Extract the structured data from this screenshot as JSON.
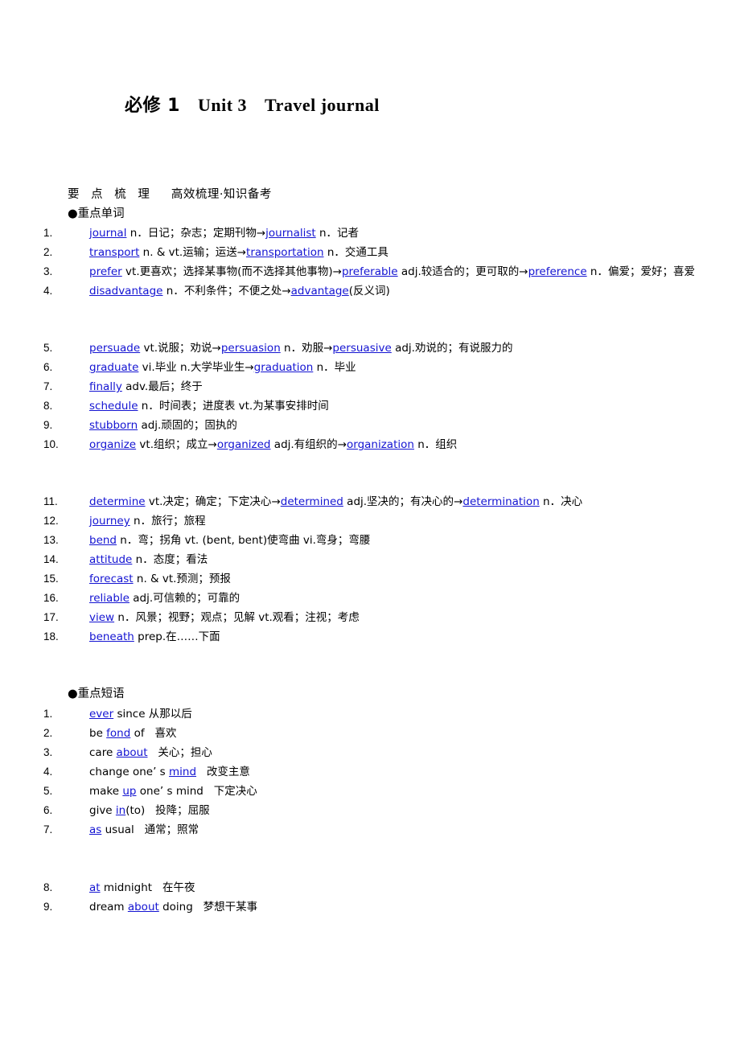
{
  "title": {
    "part1": "必修 1",
    "part2": "Unit 3",
    "part3": "Travel journal"
  },
  "section_header": {
    "label": "要 点 梳 理",
    "subtitle": "高效梳理·知识备考"
  },
  "words_heading": "●重点单词",
  "phrases_heading": "●重点短语",
  "words": [
    {
      "num": "1.",
      "html": "<span class=\"lnk\">journal</span> n．日记；杂志；定期刊物<span class=\"arrow\">→</span><span class=\"lnk\">journalist</span> n．记者"
    },
    {
      "num": "2.",
      "html": "<span class=\"lnk\">transport</span> n. &amp; vt.运输；运送<span class=\"arrow\">→</span><span class=\"lnk\">transportation</span> n．交通工具"
    },
    {
      "num": "3.",
      "html": "<span class=\"lnk\">prefer</span> vt.更喜欢；选择某事物(而不选择其他事物)<span class=\"arrow\">→</span><span class=\"lnk\">preferable</span> adj.较适合的；更可取的<span class=\"arrow\">→</span><span class=\"lnk\">preference</span> n．偏爱；爱好；喜爱"
    },
    {
      "num": "4.",
      "html": "<span class=\"lnk\">disadvantage</span> n．不利条件；不便之处<span class=\"arrow\">→</span><span class=\"lnk\">advantage</span>(反义词)"
    },
    {
      "num": "5.",
      "html": "<span class=\"lnk\">persuade</span> vt.说服；劝说<span class=\"arrow\">→</span><span class=\"lnk\">persuasion</span> n．劝服<span class=\"arrow\">→</span><span class=\"lnk\">persuasive</span> adj.劝说的；有说服力的"
    },
    {
      "num": "6.",
      "html": "<span class=\"lnk\">graduate</span> vi.毕业 n.大学毕业生<span class=\"arrow\">→</span><span class=\"lnk\">graduation</span> n．毕业"
    },
    {
      "num": "7.",
      "html": "<span class=\"lnk\">finally</span> adv.最后；终于"
    },
    {
      "num": "8.",
      "html": "<span class=\"lnk\">schedule</span> n．时间表；进度表 vt.为某事安排时间"
    },
    {
      "num": "9.",
      "html": "<span class=\"lnk\">stubborn</span> adj.顽固的；固执的"
    },
    {
      "num": "10.",
      "html": "<span class=\"lnk\">organize</span> vt.组织；成立<span class=\"arrow\">→</span><span class=\"lnk\">organized</span> adj.有组织的<span class=\"arrow\">→</span><span class=\"lnk\">organization</span> n．组织"
    },
    {
      "num": "11.",
      "html": "<span class=\"lnk\">determine</span> vt.决定；确定；下定决心<span class=\"arrow\">→</span><span class=\"lnk\">determined</span> adj.坚决的；有决心的<span class=\"arrow\">→</span><span class=\"lnk\">determination</span> n．决心"
    },
    {
      "num": "12.",
      "html": "<span class=\"lnk\">journey</span> n．旅行；旅程"
    },
    {
      "num": "13.",
      "html": "<span class=\"lnk\">bend</span> n．弯；拐角 vt. (bent, bent)使弯曲 vi.弯身；弯腰"
    },
    {
      "num": "14.",
      "html": "<span class=\"lnk\">attitude</span> n．态度；看法"
    },
    {
      "num": "15.",
      "html": "<span class=\"lnk\">forecast</span> n. &amp; vt.预测；预报"
    },
    {
      "num": "16.",
      "html": "<span class=\"lnk\">reliable</span> adj.可信赖的；可靠的"
    },
    {
      "num": "17.",
      "html": "<span class=\"lnk\">view</span> n．风景；视野；观点；见解 vt.观看；注视；考虑"
    },
    {
      "num": "18.",
      "html": "<span class=\"lnk\">beneath</span> prep.在……下面"
    }
  ],
  "phrases": [
    {
      "num": "1.",
      "html": "<span class=\"lnk\">ever</span> since 从那以后"
    },
    {
      "num": "2.",
      "html": "be <span class=\"lnk\">fond</span> of&nbsp;&nbsp; 喜欢"
    },
    {
      "num": "3.",
      "html": "care <span class=\"lnk\">about</span>&nbsp;&nbsp; 关心；担心"
    },
    {
      "num": "4.",
      "html": "change one’ s <span class=\"lnk\">mind</span>&nbsp;&nbsp; 改变主意"
    },
    {
      "num": "5.",
      "html": "make <span class=\"lnk\">up</span> one’ s mind&nbsp;&nbsp; 下定决心"
    },
    {
      "num": "6.",
      "html": "give <span class=\"lnk\">in</span>(to)&nbsp;&nbsp; 投降；屈服"
    },
    {
      "num": "7.",
      "html": "<span class=\"lnk\">as</span> usual&nbsp;&nbsp; 通常；照常"
    },
    {
      "num": "8.",
      "html": "<span class=\"lnk\">at</span> midnight&nbsp;&nbsp; 在午夜"
    },
    {
      "num": "9.",
      "html": "dream <span class=\"lnk\">about</span> doing&nbsp;&nbsp; 梦想干某事"
    }
  ],
  "colors": {
    "link": "#1414d2",
    "text": "#000000",
    "background": "#ffffff"
  }
}
